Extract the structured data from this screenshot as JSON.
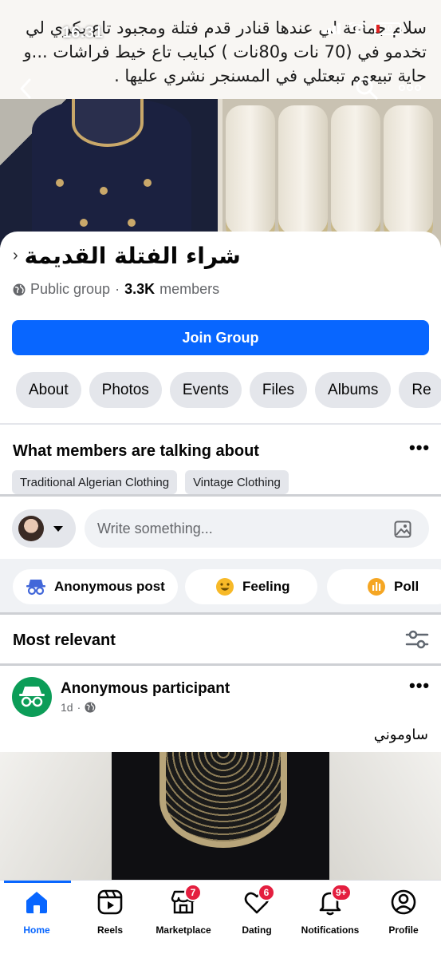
{
  "status_bar": {
    "time": "16:31",
    "battery": "10"
  },
  "cover": {
    "caption": "سلام جماعة لي عندها قنادر قدم فتلة ومجبود تاع بكري لي تخدمو في (70 نات و80نات ) كبايب تاع خيط فراشات ...و حاية تبيعهم تبعتلي في المسنجر نشري عليها ."
  },
  "group": {
    "title": "شراء الفتلة القديمة",
    "privacy": "Public group",
    "separator": "·",
    "member_count": "3.3K",
    "members_label": "members",
    "join_label": "Join Group"
  },
  "tabs": [
    "About",
    "Photos",
    "Events",
    "Files",
    "Albums",
    "Re"
  ],
  "talking": {
    "title": "What members are talking about",
    "topics": [
      "Traditional Algerian Clothing",
      "Vintage Clothing"
    ]
  },
  "composer": {
    "placeholder": "Write something..."
  },
  "actions": {
    "anonymous": "Anonymous post",
    "feeling": "Feeling",
    "poll": "Poll"
  },
  "feed": {
    "sort_label": "Most relevant"
  },
  "post": {
    "author": "Anonymous participant",
    "time": "1d",
    "separator": "·",
    "text": "ساوموني"
  },
  "bottom_nav": {
    "items": [
      {
        "label": "Home",
        "icon": "home-icon",
        "badge": ""
      },
      {
        "label": "Reels",
        "icon": "reels-icon",
        "badge": ""
      },
      {
        "label": "Marketplace",
        "icon": "marketplace-icon",
        "badge": "7"
      },
      {
        "label": "Dating",
        "icon": "dating-icon",
        "badge": "6"
      },
      {
        "label": "Notifications",
        "icon": "bell-icon",
        "badge": "9+"
      },
      {
        "label": "Profile",
        "icon": "profile-icon",
        "badge": ""
      }
    ]
  },
  "colors": {
    "primary": "#0866ff",
    "chip_bg": "#e4e6eb",
    "badge": "#e41e3f",
    "anonymous_avatar": "#0c9d58",
    "feeling": "#f7b928",
    "poll": "#f5a623"
  }
}
